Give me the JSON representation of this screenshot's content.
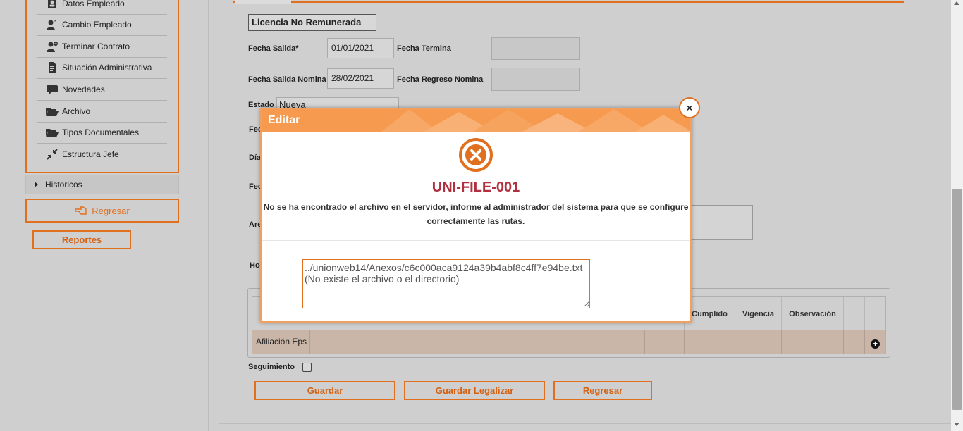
{
  "sidebar": {
    "items": [
      {
        "label": "Datos Empleado",
        "icon": "id-card-icon"
      },
      {
        "label": "Cambio Empleado",
        "icon": "user-star-icon"
      },
      {
        "label": "Terminar Contrato",
        "icon": "user-minus-icon"
      },
      {
        "label": "Situación Administrativa",
        "icon": "document-icon"
      },
      {
        "label": "Novedades",
        "icon": "comment-icon"
      },
      {
        "label": "Archivo",
        "icon": "folder-open-icon"
      },
      {
        "label": "Tipos Documentales",
        "icon": "folder-open-icon"
      },
      {
        "label": "Estructura Jefe",
        "icon": "compress-icon"
      }
    ],
    "historicos": "Historicos",
    "regresar": "Regresar",
    "reportes": "Reportes"
  },
  "form": {
    "title": "Licencia No Remunerada",
    "fecha_salida_label": "Fecha Salida*",
    "fecha_salida_value": "01/01/2021",
    "fecha_termina_label": "Fecha Termina",
    "fecha_salida_nomina_label": "Fecha Salida Nomina",
    "fecha_salida_nomina_value": "28/02/2021",
    "fecha_regreso_nomina_label": "Fecha Regreso Nomina",
    "estado_label": "Estado",
    "estado_value": "Nueva",
    "partial_labels": [
      "Fec",
      "Día",
      "Fec",
      "Are",
      "Ho"
    ],
    "seguimiento_label": "Seguimiento"
  },
  "grid": {
    "columns": [
      "Cumplido",
      "Vigencia",
      "Observación"
    ],
    "rows": [
      {
        "label": "Afiliación Eps"
      }
    ]
  },
  "buttons": {
    "guardar": "Guardar",
    "guardar_legalizar": "Guardar Legalizar",
    "regresar": "Regresar"
  },
  "modal": {
    "title": "Editar",
    "close": "×",
    "error_code": "UNI-FILE-001",
    "error_message_line1": "No se ha encontrado el archivo en el servidor, informe al administrador del sistema para que se configure",
    "error_message_line2": "correctamente las rutas.",
    "error_detail": "../unionweb14/Anexos/c6c000aca9124a39b4abf8c4ff7e94be.txt\n(No existe el archivo o el directorio)"
  },
  "colors": {
    "accent": "#e07020",
    "modal_header": "#f59a4e",
    "error_code": "#b03040"
  }
}
